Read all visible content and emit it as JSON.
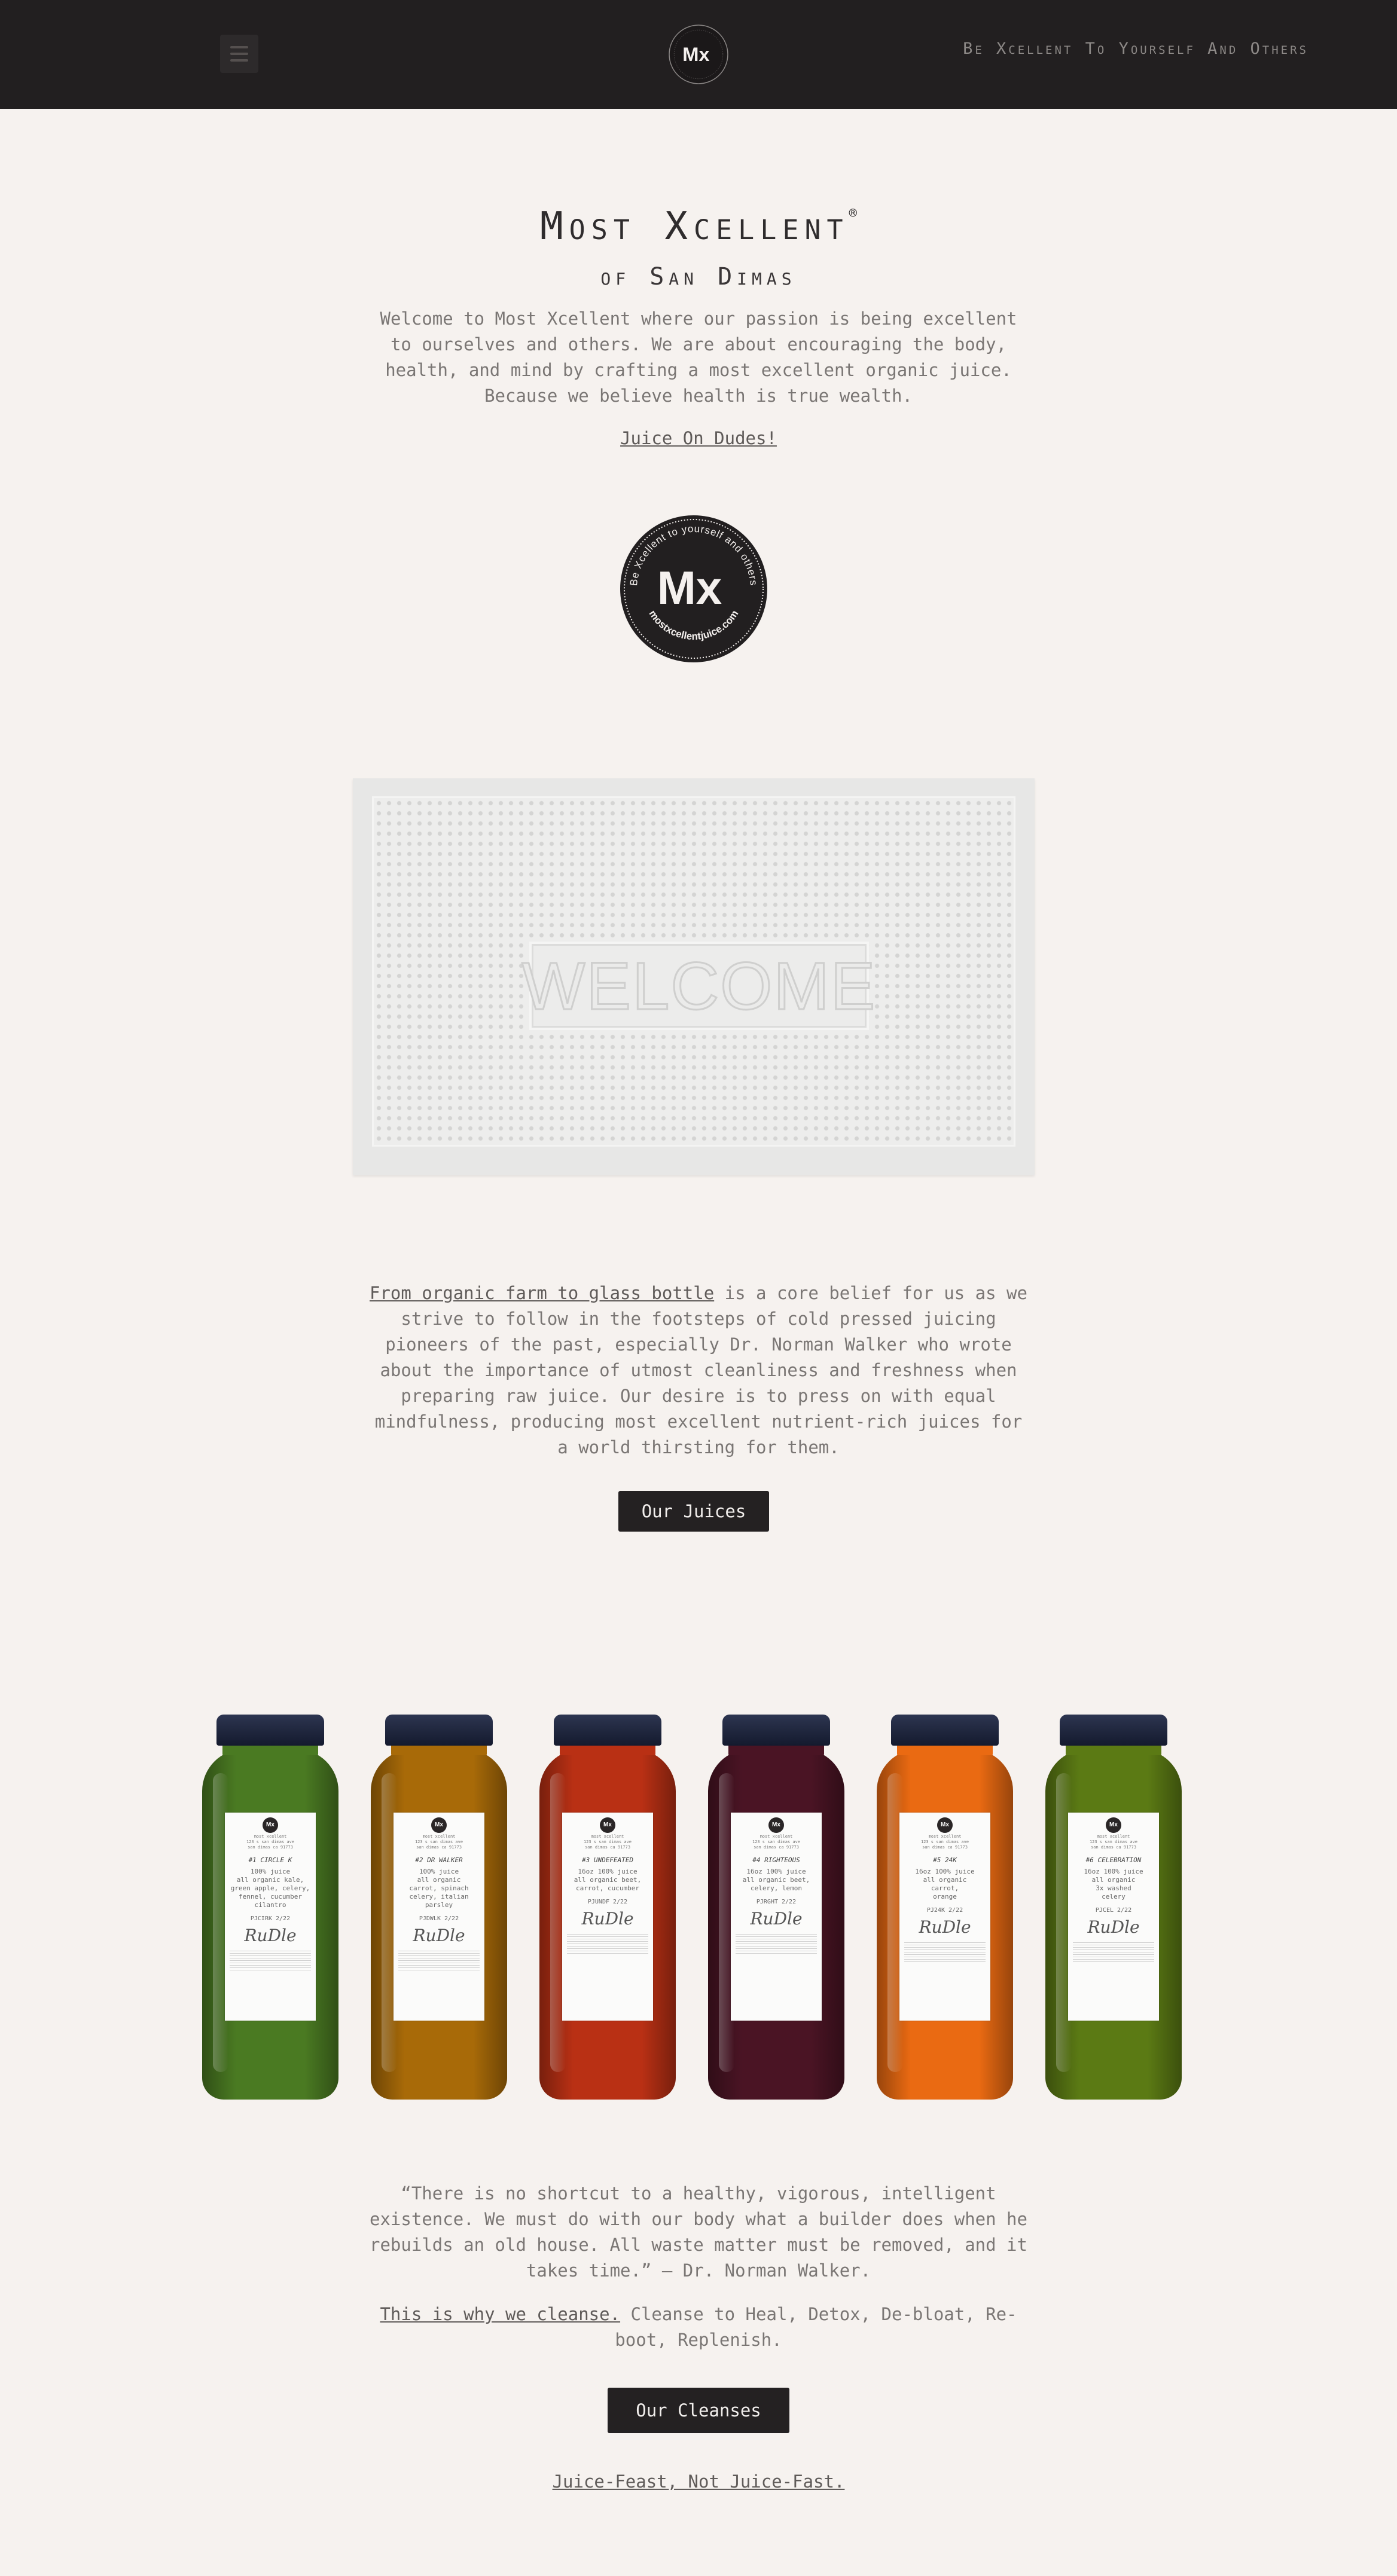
{
  "header": {
    "logo_text": "Mx",
    "logo_ring_text": "Be Xcellent to yourself and others",
    "tagline": "Be Xcellent To Yourself And Others"
  },
  "hero": {
    "title": "Most Xcellent",
    "registered_mark": "®",
    "subtitle": "of San Dimas",
    "intro_lines": [
      "Welcome to Most Xcellent where our passion is being excellent",
      "to ourselves and others. We are about encouraging the body,",
      "health, and mind by crafting a most excellent organic juice.",
      "Because we believe health is true wealth."
    ],
    "cta_link": "Juice On Dudes!"
  },
  "seal": {
    "mark": "Mx",
    "ring_top": "Be Xcellent to yourself and others",
    "ring_bottom": "mostxcellentjuice.com"
  },
  "welcome_mat": {
    "word": "WELCOME"
  },
  "farm": {
    "link_text": "From organic farm to glass bottle",
    "first_line_rest": " is a core belief for us as we",
    "lines": [
      "strive to follow in the footsteps of cold pressed juicing",
      "pioneers of the past, especially Dr. Norman Walker who wrote",
      "about the importance of utmost cleanliness and freshness when",
      "preparing raw juice. Our desire is to press on with equal",
      "mindfulness, producing most excellent nutrient-rich juices for",
      "a world thirsting for them."
    ],
    "button": "Our Juices"
  },
  "bottles": [
    {
      "name": "#1 CIRCLE K",
      "desc": [
        "100% juice",
        "all organic kale,",
        "green apple, celery,",
        "fennel, cucumber",
        "cilantro"
      ],
      "batch": "PJCIRK 2/22",
      "color": "#4a7a22"
    },
    {
      "name": "#2 DR WALKER",
      "desc": [
        "100% juice",
        "all organic",
        "carrot, spinach",
        "celery, italian",
        "parsley"
      ],
      "batch": "PJDWLK 2/22",
      "color": "#a86a08"
    },
    {
      "name": "#3 UNDEFEATED",
      "desc": [
        "16oz 100% juice",
        "all organic beet,",
        "carrot, cucumber"
      ],
      "batch": "PJUNDF 2/22",
      "color": "#b93014"
    },
    {
      "name": "#4 RIGHTEOUS",
      "desc": [
        "16oz 100% juice",
        "all organic beet,",
        "celery, lemon"
      ],
      "batch": "PJRGHT 2/22",
      "color": "#4a1424"
    },
    {
      "name": "#5 24K",
      "desc": [
        "16oz 100% juice",
        "all organic",
        "carrot,",
        "orange"
      ],
      "batch": "PJ24K 2/22",
      "color": "#ea6a12"
    },
    {
      "name": "#6 CELEBRATION",
      "desc": [
        "16oz 100% juice",
        "all organic",
        "3x washed",
        "celery"
      ],
      "batch": "PJCEL 2/22",
      "color": "#5b7a14"
    }
  ],
  "bottle_label": {
    "brand": "most xcellent",
    "address": "123 s san dimas ave",
    "city": "san dimas ca 91773",
    "signature": "RuDle"
  },
  "quote": {
    "lines": [
      "“There is no shortcut to a healthy, vigorous, intelligent",
      "existence. We must do with our body what a builder does when he",
      "rebuilds an old house. All waste matter must be removed, and it",
      "takes time.” – Dr. Norman Walker."
    ]
  },
  "cleanse": {
    "link_text": "This is why we cleanse.",
    "line1_rest": " Cleanse to Heal, Detox, De-bloat, Re-",
    "line2": "boot, Replenish.",
    "button": "Our Cleanses",
    "footer_link": "Juice-Feast, Not Juice-Fast."
  }
}
